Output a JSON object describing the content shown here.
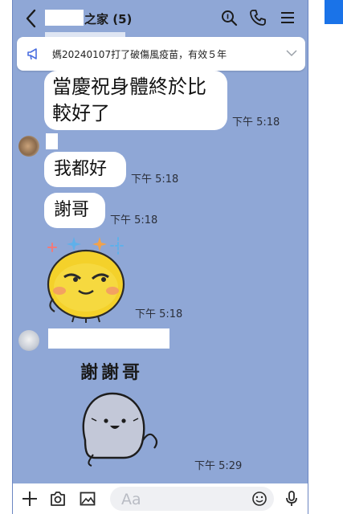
{
  "header": {
    "title": "之家 (5)",
    "icons": [
      "back-icon",
      "search-icon",
      "phone-icon",
      "menu-icon"
    ]
  },
  "announcement": {
    "text": "媽20240107打了破傷風疫苗，有效５年",
    "icon": "megaphone-icon"
  },
  "messages": [
    {
      "text": "當慶祝身體終於比較好了",
      "line1": "當慶祝身體終於比",
      "line2": "較好了",
      "time": "下午 5:18"
    },
    {
      "text": "我都好",
      "time": "下午 5:18"
    },
    {
      "text": "謝哥",
      "time": "下午 5:18"
    },
    {
      "sticker": "smug-yellow-face-sticker",
      "time": "下午 5:18"
    },
    {
      "sticker_text": "謝謝哥",
      "sticker": "grey-ghost-sticker",
      "time": "下午 5:29"
    }
  ],
  "composer": {
    "placeholder": "Aa",
    "icons": [
      "plus-icon",
      "camera-icon",
      "image-icon",
      "emoji-icon",
      "mic-icon"
    ]
  },
  "colors": {
    "chat_background": "#8fa7d6",
    "bubble": "#ffffff",
    "accent": "#1a73e8"
  }
}
